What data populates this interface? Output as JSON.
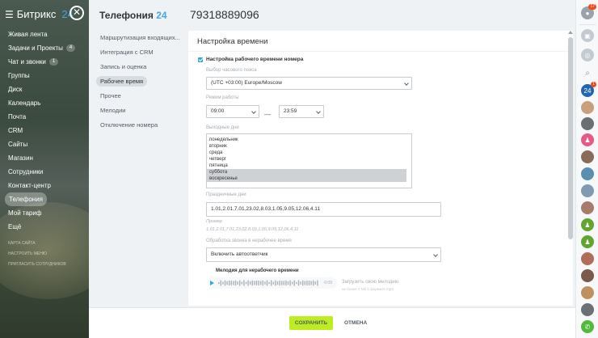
{
  "app": {
    "logo_text": "Битрикс",
    "logo_num": "24"
  },
  "left_nav": [
    {
      "label": "Живая лента"
    },
    {
      "label": "Задачи и Проекты",
      "badge": "4"
    },
    {
      "label": "Чат и звонки",
      "badge": "1"
    },
    {
      "label": "Группы"
    },
    {
      "label": "Диск"
    },
    {
      "label": "Календарь"
    },
    {
      "label": "Почта"
    },
    {
      "label": "CRM"
    },
    {
      "label": "Сайты"
    },
    {
      "label": "Магазин"
    },
    {
      "label": "Сотрудники"
    },
    {
      "label": "Контакт-центр"
    },
    {
      "label": "Телефония",
      "active": true
    },
    {
      "label": "Мой тариф"
    },
    {
      "label": "Ещё"
    }
  ],
  "left_small": [
    "КАРТА САЙТА",
    "НАСТРОИТЬ МЕНЮ",
    "ПРИГЛАСИТЬ СОТРУДНИКОВ"
  ],
  "header": {
    "title": "Телефония",
    "title_num": "24",
    "phone": "79318889096"
  },
  "settings_nav": [
    {
      "label": "Маршрутизация входящих..."
    },
    {
      "label": "Интеграция с CRM"
    },
    {
      "label": "Запись и оценка"
    },
    {
      "label": "Рабочее время",
      "active": true
    },
    {
      "label": "Прочее"
    },
    {
      "label": "Мелодии"
    },
    {
      "label": "Отключение номера"
    }
  ],
  "card": {
    "title": "Настройка времени",
    "enable_label": "Настройка рабочего времени номера",
    "timezone_label": "Выбор часового пояса",
    "timezone_value": "(UTC +03:00) Europe/Moscow",
    "work_mode_label": "Режим работы",
    "time_from": "09:00",
    "time_to": "23:59",
    "time_sep": "—",
    "weekend_label": "Выходные дни",
    "days": [
      {
        "label": "понедельник",
        "selected": false
      },
      {
        "label": "вторник",
        "selected": false
      },
      {
        "label": "среда",
        "selected": false
      },
      {
        "label": "четверг",
        "selected": false
      },
      {
        "label": "пятница",
        "selected": false
      },
      {
        "label": "суббота",
        "selected": true
      },
      {
        "label": "воскресенье",
        "selected": true
      }
    ],
    "holidays_label": "Праздничные дни",
    "holidays_value": "1.01,2.01,7.01,23.02,8.03,1.05,9.05,12.06,4.11",
    "example_label": "Пример",
    "example_value": "1.01,2.01,7.01,23.02,8.03,1.05,9.05,12.06,4.11",
    "offhours_label": "Обработка звонка в нерабочее время",
    "offhours_value": "Включить автоответчик",
    "melody_title": "Мелодия для нерабочего времени",
    "player_time": "-0:09",
    "upload_label": "Загрузить свою мелодию",
    "upload_hint": "не более 2 Мб в формате mp3"
  },
  "footer": {
    "save": "СОХРАНИТЬ",
    "cancel": "ОТМЕНА"
  },
  "right_sidebar": {
    "notif_badge": "17",
    "chat_badge": "1",
    "counter": "24"
  },
  "colors": {
    "accent": "#2fa8e0",
    "save": "#bbed21",
    "brand24": "#41a7e1"
  }
}
